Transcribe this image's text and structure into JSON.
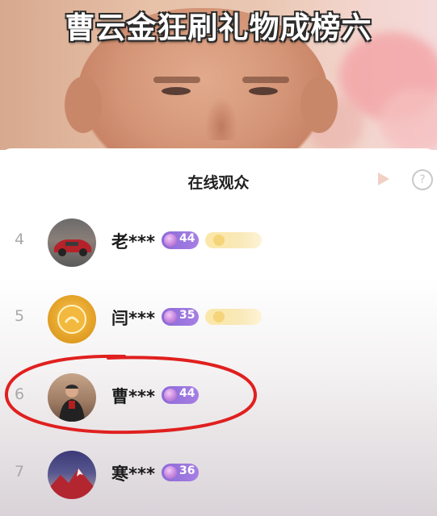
{
  "video": {
    "headline": "曹云金狂刷礼物成榜六"
  },
  "panel": {
    "title": "在线观众"
  },
  "viewers": [
    {
      "rank": "4",
      "name": "老***",
      "level": "44",
      "avatar": "car-avatar",
      "has_badge": true
    },
    {
      "rank": "5",
      "name": "闫***",
      "level": "35",
      "avatar": "gold-avatar",
      "has_badge": true
    },
    {
      "rank": "6",
      "name": "曹***",
      "level": "44",
      "avatar": "person-avatar",
      "has_badge": false
    },
    {
      "rank": "7",
      "name": "寒***",
      "level": "36",
      "avatar": "mountain-avatar",
      "has_badge": false
    }
  ],
  "colors": {
    "level_badge": "#8b6ad8",
    "fan_badge": "#fbe7a6",
    "annotation": "#e0201f"
  },
  "icons": [
    "share-icon",
    "help-icon",
    "gem-icon"
  ]
}
